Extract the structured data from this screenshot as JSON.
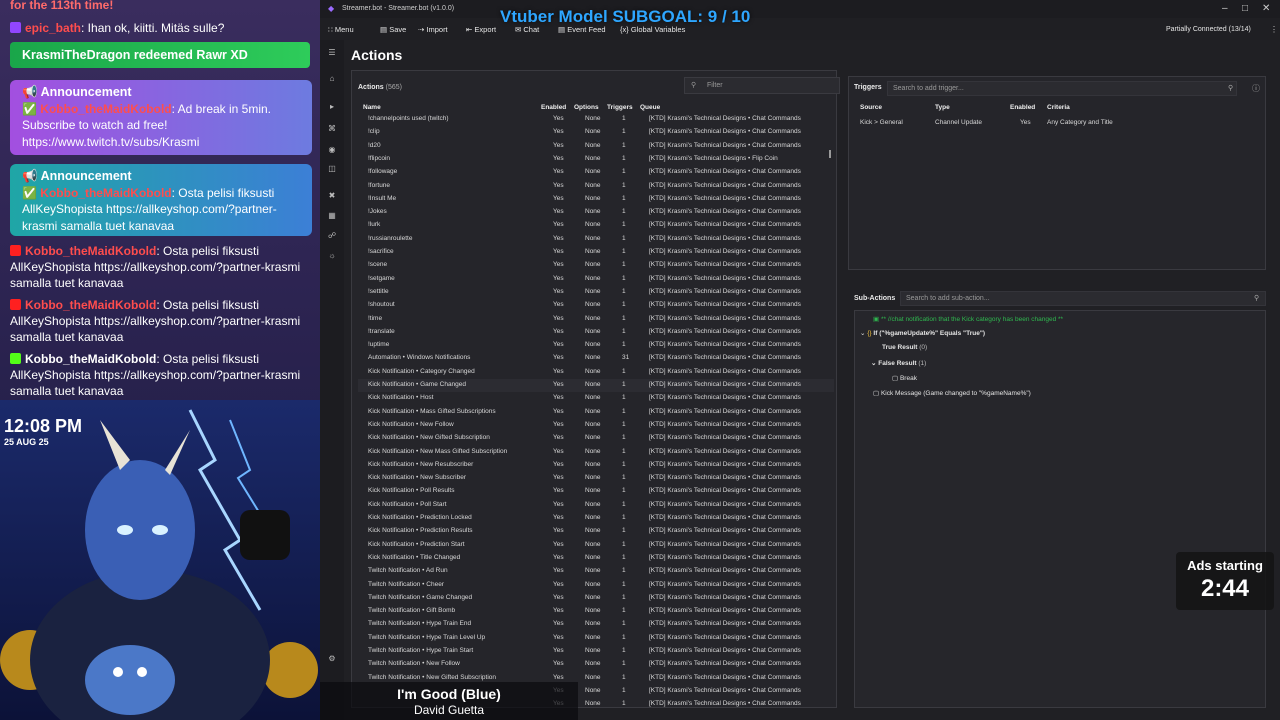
{
  "overlay": {
    "chat_top": "for the 113th time!",
    "chat_line1": {
      "name": "epic_bath",
      "text": ": Ihan ok, kiitti. Mitäs sulle?"
    },
    "redeem": "KrasmiTheDragon redeemed Rawr XD",
    "announcement1": {
      "head": "Announcement",
      "name": "Kobbo_theMaidKobold",
      "text": ": Ad break in 5min. Subscribe to watch ad free! https://www.twitch.tv/subs/Krasmi"
    },
    "announcement2": {
      "head": "Announcement",
      "name": "Kobbo_theMaidKobold",
      "text": ": Osta pelisi fiksusti AllKeyShopista https://allkeyshop.com/?partner-krasmi samalla tuet kanavaa"
    },
    "chat_msgs": [
      {
        "name": "Kobbo_theMaidKobold",
        "text": ": Osta pelisi fiksusti AllKeyShopista https://allkeyshop.com/?partner-krasmi samalla tuet kanavaa"
      },
      {
        "name": "Kobbo_theMaidKobold",
        "text": ": Osta pelisi fiksusti AllKeyShopista https://allkeyshop.com/?partner-krasmi samalla tuet kanavaa"
      },
      {
        "name": "Kobbo_theMaidKobold",
        "text": ": Osta pelisi fiksusti AllKeyShopista https://allkeyshop.com/?partner-krasmi samalla tuet kanavaa"
      }
    ],
    "clock": "12:08 PM",
    "date": "25 AUG 25",
    "ads_label": "Ads starting",
    "ads_time": "2:44",
    "now_playing": {
      "song": "I'm Good (Blue)",
      "artist": "David Guetta"
    }
  },
  "app": {
    "window_title": "Streamer.bot - Streamer.bot (v1.0.0)",
    "subgoal": "Vtuber Model SUBGOAL: 9 / 10",
    "connection": "Partially Connected (13/14)",
    "toolbar": [
      "Menu",
      "Save",
      "Import",
      "Export",
      "Chat",
      "Event Feed",
      "Global Variables"
    ],
    "section_title": "Actions",
    "actions_label": "Actions",
    "actions_count": "(565)",
    "filter_placeholder": "Filter",
    "columns": [
      "Name",
      "Enabled",
      "Options",
      "Triggers",
      "Queue"
    ],
    "rows": [
      [
        "!channelpoints used (twitch)",
        "Yes",
        "None",
        "1",
        "[KTD] Krasmi's Technical Designs • Chat Commands"
      ],
      [
        "!clip",
        "Yes",
        "None",
        "1",
        "[KTD] Krasmi's Technical Designs • Chat Commands"
      ],
      [
        "!d20",
        "Yes",
        "None",
        "1",
        "[KTD] Krasmi's Technical Designs • Chat Commands"
      ],
      [
        "!flipcoin",
        "Yes",
        "None",
        "1",
        "[KTD] Krasmi's Technical Designs • Flip Coin"
      ],
      [
        "!followage",
        "Yes",
        "None",
        "1",
        "[KTD] Krasmi's Technical Designs • Chat Commands"
      ],
      [
        "!fortune",
        "Yes",
        "None",
        "1",
        "[KTD] Krasmi's Technical Designs • Chat Commands"
      ],
      [
        "!Insult Me",
        "Yes",
        "None",
        "1",
        "[KTD] Krasmi's Technical Designs • Chat Commands"
      ],
      [
        "!Jokes",
        "Yes",
        "None",
        "1",
        "[KTD] Krasmi's Technical Designs • Chat Commands"
      ],
      [
        "!lurk",
        "Yes",
        "None",
        "1",
        "[KTD] Krasmi's Technical Designs • Chat Commands"
      ],
      [
        "!russianroulette",
        "Yes",
        "None",
        "1",
        "[KTD] Krasmi's Technical Designs • Chat Commands"
      ],
      [
        "!sacrifice",
        "Yes",
        "None",
        "1",
        "[KTD] Krasmi's Technical Designs • Chat Commands"
      ],
      [
        "!scene",
        "Yes",
        "None",
        "1",
        "[KTD] Krasmi's Technical Designs • Chat Commands"
      ],
      [
        "!setgame",
        "Yes",
        "None",
        "1",
        "[KTD] Krasmi's Technical Designs • Chat Commands"
      ],
      [
        "!settitle",
        "Yes",
        "None",
        "1",
        "[KTD] Krasmi's Technical Designs • Chat Commands"
      ],
      [
        "!shoutout",
        "Yes",
        "None",
        "1",
        "[KTD] Krasmi's Technical Designs • Chat Commands"
      ],
      [
        "!time",
        "Yes",
        "None",
        "1",
        "[KTD] Krasmi's Technical Designs • Chat Commands"
      ],
      [
        "!translate",
        "Yes",
        "None",
        "1",
        "[KTD] Krasmi's Technical Designs • Chat Commands"
      ],
      [
        "!uptime",
        "Yes",
        "None",
        "1",
        "[KTD] Krasmi's Technical Designs • Chat Commands"
      ],
      [
        "Automation • Windows Notifications",
        "Yes",
        "None",
        "31",
        "[KTD] Krasmi's Technical Designs • Chat Commands"
      ],
      [
        "Kick Notification • Category Changed",
        "Yes",
        "None",
        "1",
        "[KTD] Krasmi's Technical Designs • Chat Commands"
      ],
      [
        "Kick Notification • Game Changed",
        "Yes",
        "None",
        "1",
        "[KTD] Krasmi's Technical Designs • Chat Commands"
      ],
      [
        "Kick Notification • Host",
        "Yes",
        "None",
        "1",
        "[KTD] Krasmi's Technical Designs • Chat Commands"
      ],
      [
        "Kick Notification • Mass Gifted Subscriptions",
        "Yes",
        "None",
        "1",
        "[KTD] Krasmi's Technical Designs • Chat Commands"
      ],
      [
        "Kick Notification • New Follow",
        "Yes",
        "None",
        "1",
        "[KTD] Krasmi's Technical Designs • Chat Commands"
      ],
      [
        "Kick Notification • New Gifted Subscription",
        "Yes",
        "None",
        "1",
        "[KTD] Krasmi's Technical Designs • Chat Commands"
      ],
      [
        "Kick Notification • New Mass Gifted Subscription",
        "Yes",
        "None",
        "1",
        "[KTD] Krasmi's Technical Designs • Chat Commands"
      ],
      [
        "Kick Notification • New Resubscriber",
        "Yes",
        "None",
        "1",
        "[KTD] Krasmi's Technical Designs • Chat Commands"
      ],
      [
        "Kick Notification • New Subscriber",
        "Yes",
        "None",
        "1",
        "[KTD] Krasmi's Technical Designs • Chat Commands"
      ],
      [
        "Kick Notification • Poll Results",
        "Yes",
        "None",
        "1",
        "[KTD] Krasmi's Technical Designs • Chat Commands"
      ],
      [
        "Kick Notification • Poll Start",
        "Yes",
        "None",
        "1",
        "[KTD] Krasmi's Technical Designs • Chat Commands"
      ],
      [
        "Kick Notification • Prediction Locked",
        "Yes",
        "None",
        "1",
        "[KTD] Krasmi's Technical Designs • Chat Commands"
      ],
      [
        "Kick Notification • Prediction Results",
        "Yes",
        "None",
        "1",
        "[KTD] Krasmi's Technical Designs • Chat Commands"
      ],
      [
        "Kick Notification • Prediction Start",
        "Yes",
        "None",
        "1",
        "[KTD] Krasmi's Technical Designs • Chat Commands"
      ],
      [
        "Kick Notification • Title Changed",
        "Yes",
        "None",
        "1",
        "[KTD] Krasmi's Technical Designs • Chat Commands"
      ],
      [
        "Twitch Notification • Ad Run",
        "Yes",
        "None",
        "1",
        "[KTD] Krasmi's Technical Designs • Chat Commands"
      ],
      [
        "Twitch Notification • Cheer",
        "Yes",
        "None",
        "1",
        "[KTD] Krasmi's Technical Designs • Chat Commands"
      ],
      [
        "Twitch Notification • Game Changed",
        "Yes",
        "None",
        "1",
        "[KTD] Krasmi's Technical Designs • Chat Commands"
      ],
      [
        "Twitch Notification • Gift Bomb",
        "Yes",
        "None",
        "1",
        "[KTD] Krasmi's Technical Designs • Chat Commands"
      ],
      [
        "Twitch Notification • Hype Train End",
        "Yes",
        "None",
        "1",
        "[KTD] Krasmi's Technical Designs • Chat Commands"
      ],
      [
        "Twitch Notification • Hype Train Level Up",
        "Yes",
        "None",
        "1",
        "[KTD] Krasmi's Technical Designs • Chat Commands"
      ],
      [
        "Twitch Notification • Hype Train Start",
        "Yes",
        "None",
        "1",
        "[KTD] Krasmi's Technical Designs • Chat Commands"
      ],
      [
        "Twitch Notification • New Follow",
        "Yes",
        "None",
        "1",
        "[KTD] Krasmi's Technical Designs • Chat Commands"
      ],
      [
        "Twitch Notification • New Gifted Subscription",
        "Yes",
        "None",
        "1",
        "[KTD] Krasmi's Technical Designs • Chat Commands"
      ],
      [
        "",
        "Yes",
        "None",
        "1",
        "[KTD] Krasmi's Technical Designs • Chat Commands"
      ],
      [
        "",
        "Yes",
        "None",
        "1",
        "[KTD] Krasmi's Technical Designs • Chat Commands"
      ]
    ],
    "triggers": {
      "label": "Triggers",
      "search_placeholder": "Search to add trigger...",
      "columns": [
        "Source",
        "Type",
        "Enabled",
        "Criteria"
      ],
      "row": [
        "Kick > General",
        "Channel Update",
        "Yes",
        "Any Category and Title"
      ]
    },
    "subactions": {
      "label": "Sub-Actions",
      "search_placeholder": "Search to add sub-action...",
      "comment": "** //chat notification that the Kick category has been changed **",
      "if_line": "If (\"%gameUpdate%\" Equals \"True\")",
      "true_result": "True Result",
      "true_count": "(0)",
      "false_result": "False Result",
      "false_count": "(1)",
      "break": "Break",
      "kick_message": "Kick Message (Game changed to \"%gameName%\")"
    }
  }
}
